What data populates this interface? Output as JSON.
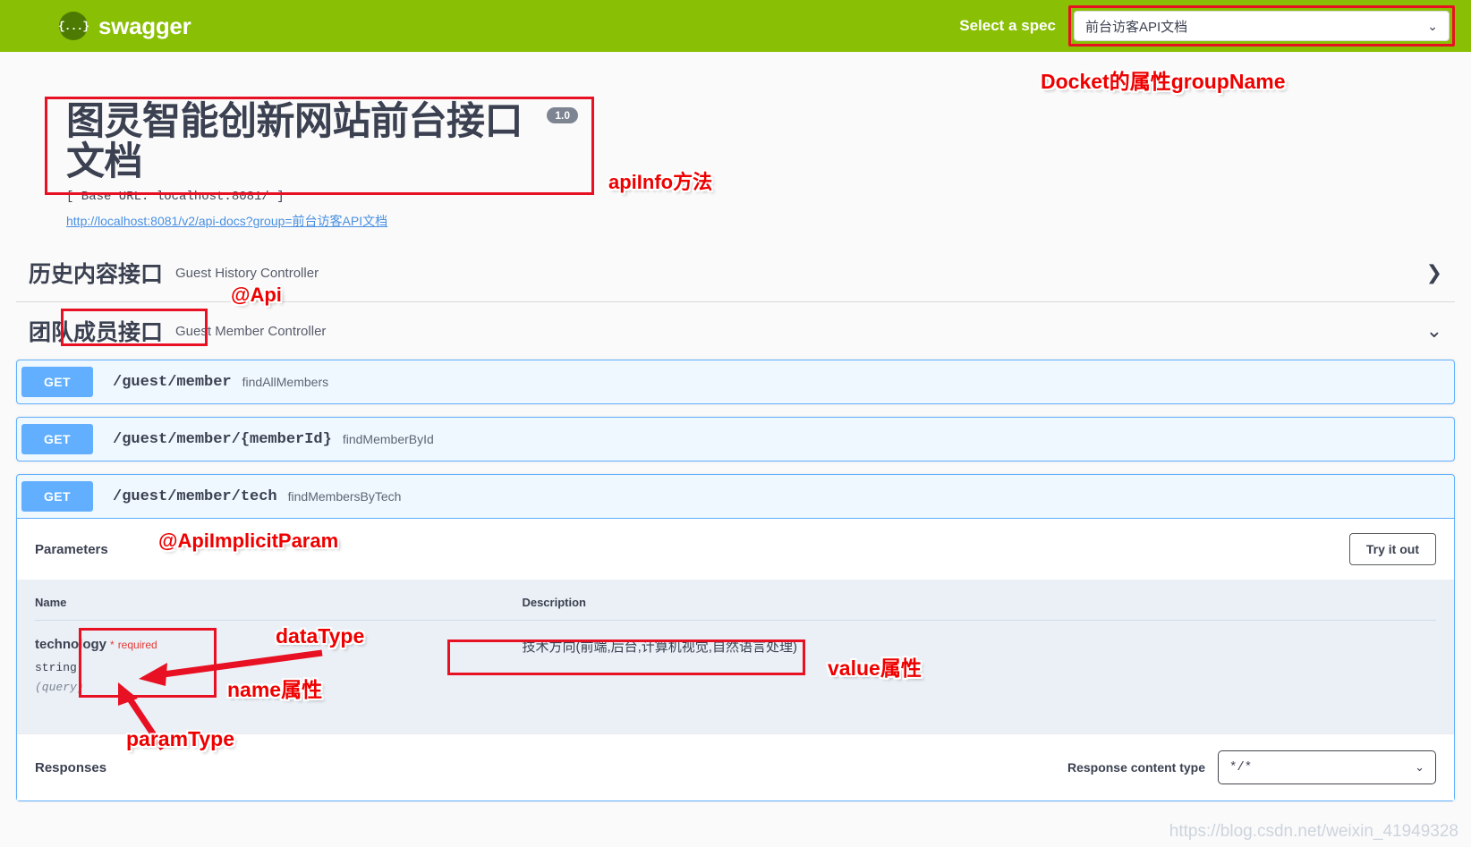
{
  "topbar": {
    "logo_text": "swagger",
    "logo_mark": "{...}",
    "spec_label": "Select a spec",
    "spec_value": "前台访客API文档",
    "chevron": "⌄"
  },
  "info": {
    "title": "图灵智能创新网站前台接口文档",
    "version": "1.0",
    "base_url": "[ Base URL: localhost:8081/ ]",
    "docs_link": "http://localhost:8081/v2/api-docs?group=前台访客API文档"
  },
  "tags": [
    {
      "name": "历史内容接口",
      "description": "Guest History Controller",
      "chevron": "❯",
      "expanded": false
    },
    {
      "name": "团队成员接口",
      "description": "Guest Member Controller",
      "chevron": "⌄",
      "expanded": true
    }
  ],
  "operations": [
    {
      "method": "GET",
      "path": "/guest/member",
      "summary": "findAllMembers"
    },
    {
      "method": "GET",
      "path": "/guest/member/{memberId}",
      "summary": "findMemberById"
    },
    {
      "method": "GET",
      "path": "/guest/member/tech",
      "summary": "findMembersByTech"
    }
  ],
  "expanded_operation": {
    "parameters_title": "Parameters",
    "try_it_out_label": "Try it out",
    "columns": {
      "name": "Name",
      "description": "Description"
    },
    "rows": [
      {
        "name": "technology",
        "required_marker": "*",
        "required_label": "required",
        "type": "string",
        "in": "(query)",
        "description": "技术方向(前端,后台,计算机视觉,自然语言处理)"
      }
    ],
    "responses_title": "Responses",
    "response_content_type_label": "Response content type",
    "response_content_type_value": "*/*",
    "chevron": "⌄"
  },
  "annotations": [
    {
      "id": "a1",
      "text": "Docket的属性groupName"
    },
    {
      "id": "a2",
      "text": "apiInfo方法"
    },
    {
      "id": "a3",
      "text": "@Api"
    },
    {
      "id": "a4",
      "text": "@ApiImplicitParam"
    },
    {
      "id": "a5",
      "text": "dataType"
    },
    {
      "id": "a6",
      "text": "name属性"
    },
    {
      "id": "a7",
      "text": "paramType"
    },
    {
      "id": "a8",
      "text": "value属性"
    }
  ],
  "watermark": "https://blog.csdn.net/weixin_41949328",
  "colors": {
    "brand_green": "#89bf04",
    "get_blue": "#61affe",
    "annotation_red": "#ee0000",
    "box_red": "#e81123"
  }
}
